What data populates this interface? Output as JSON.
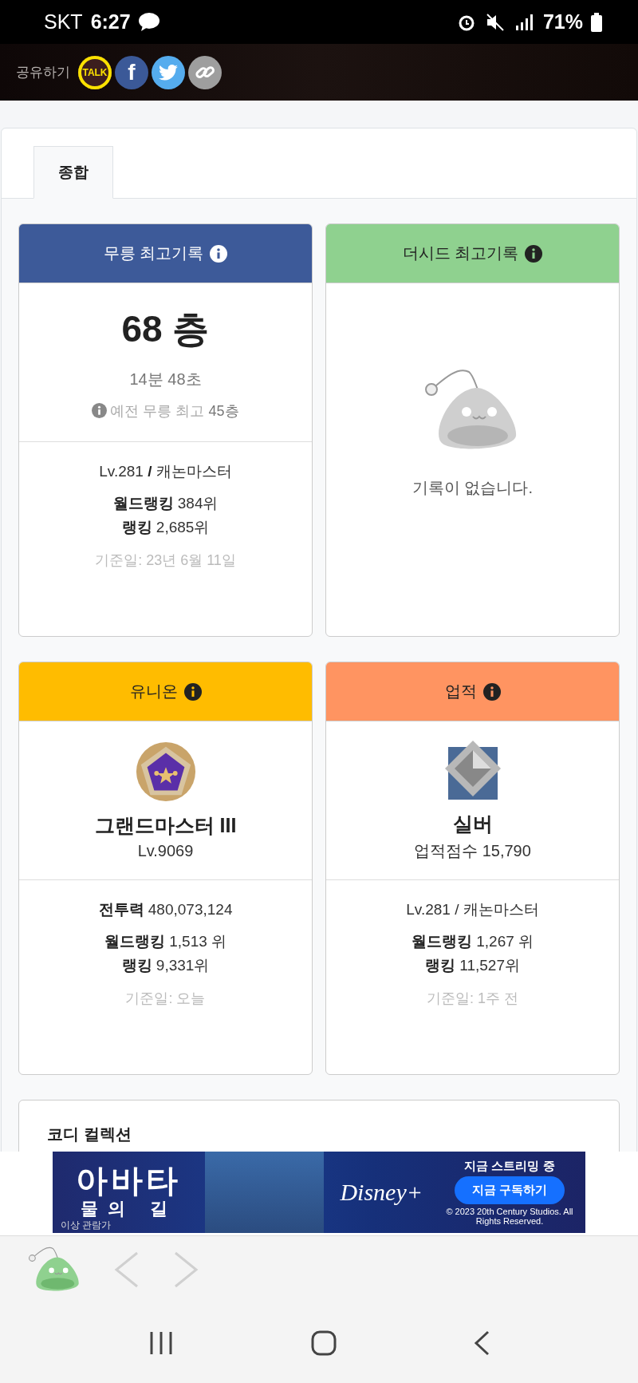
{
  "status_bar": {
    "carrier": "SKT",
    "time": "6:27",
    "battery": "71%"
  },
  "share": {
    "label": "공유하기",
    "buttons": [
      {
        "kind": "kakao",
        "label": "TALK"
      },
      {
        "kind": "facebook",
        "label": "f"
      },
      {
        "kind": "twitter"
      },
      {
        "kind": "link"
      }
    ]
  },
  "tabs": [
    {
      "label": "종합",
      "selected": true
    }
  ],
  "cards": [
    {
      "kind": "floor",
      "title": "무릉 최고기록",
      "color": "#3d5a99",
      "main": "68 층",
      "sub": "14분 48초",
      "note": "예전 무릉 최고 **45층**",
      "info": "Lv.281 **/** 캐논마스터",
      "ranks": [
        "**월드랭킹** 384위",
        "**랭킹** 2,685위"
      ],
      "date": "기준일: 23년 6월 11일"
    },
    {
      "kind": "empty",
      "title": "더시드 최고기록",
      "color": "#8fd18f",
      "message": "기록이 없습니다."
    },
    {
      "kind": "grade",
      "title": "유니온",
      "color": "#ffbc00",
      "emblem": {
        "kind": "union"
      },
      "grade": "그랜드마스터 III",
      "sub": "Lv.9069",
      "info": "**전투력** 480,073,124",
      "ranks": [
        "**월드랭킹** 1,513 위",
        "**랭킹** 9,331위"
      ],
      "date": "기준일: 오늘"
    },
    {
      "kind": "grade",
      "title": "업적",
      "color": "#ff9461",
      "emblem": {
        "kind": "silver"
      },
      "grade": "실버",
      "sub": "업적점수 15,790",
      "info": "Lv.281 / 캐논마스터",
      "ranks": [
        "**월드랭킹** 1,267 위",
        "**랭킹** 11,527위"
      ],
      "date": "기준일: 1주 전"
    }
  ],
  "coordi": {
    "title": "코디 컬렉션"
  },
  "ad": {
    "title": "아바타",
    "subtitle": "물의 길",
    "rating": "이상 관람가",
    "brand": "Disney+",
    "headline": "지금 스트리밍 중",
    "button": "지금 구독하기",
    "copyright": "© 2023 20th Century Studios. All Rights Reserved."
  },
  "browser": {
    "back_disabled": true,
    "forward_disabled": true
  }
}
